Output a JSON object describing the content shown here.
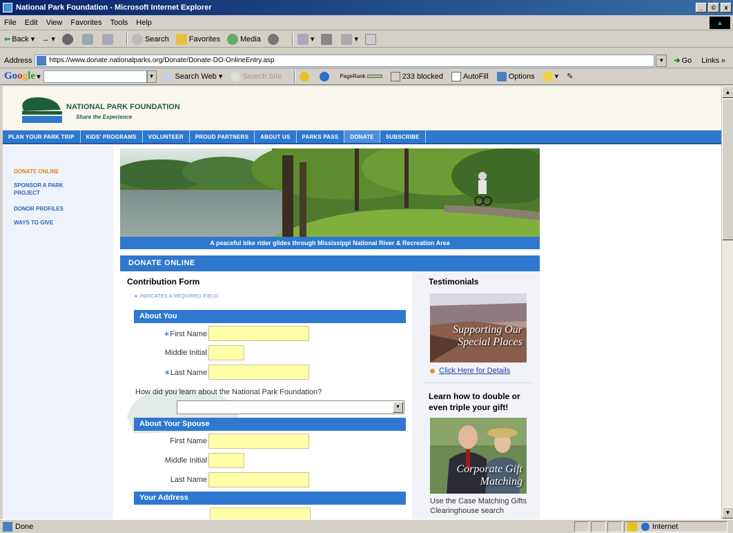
{
  "window": {
    "title": "National Park Foundation - Microsoft Internet Explorer",
    "controls": {
      "minimize": "_",
      "maximize": "©",
      "close": "x"
    }
  },
  "menu": [
    "File",
    "Edit",
    "View",
    "Favorites",
    "Tools",
    "Help"
  ],
  "toolbar": {
    "back": "Back",
    "search": "Search",
    "favorites": "Favorites",
    "media": "Media"
  },
  "address": {
    "label": "Address",
    "url": "https://www.donate.nationalparks.org/Donate/Donate-DO-OnlineEntry.asp",
    "go": "Go",
    "links": "Links »"
  },
  "google_toolbar": {
    "logo": {
      "b": "Go",
      "r": "o",
      "y": "g",
      "g": "le"
    },
    "search_web": "Search Web",
    "search_site": "Search Site",
    "pagerank": "PageRank",
    "blocked": "233 blocked",
    "autofill": "AutoFill",
    "options": "Options"
  },
  "site": {
    "name": "NATIONAL PARK FOUNDATION",
    "tagline": "Share the Experience",
    "nav": [
      "PLAN YOUR PARK TRIP",
      "KIDS' PROGRAMS",
      "VOLUNTEER",
      "PROUD PARTNERS",
      "ABOUT US",
      "PARKS PASS",
      "DONATE",
      "SUBSCRIBE"
    ],
    "active_nav_index": 6,
    "sidebar": [
      "DONATE ONLINE",
      "SPONSOR A PARK PROJECT",
      "DONOR PROFILES",
      "WAYS TO GIVE"
    ],
    "hero_caption": "A peaceful bike rider glides through Mississippi National River & Recreation Area",
    "section_title": "DONATE ONLINE"
  },
  "form": {
    "title": "Contribution Form",
    "required_note": "∗ INDICATES A REQUIRED FIELD",
    "about_you": "About You",
    "first_name": "First Name",
    "middle_initial": "Middle Initial",
    "last_name": "Last Name",
    "required_mark": "∗",
    "how_learn": "How did you learn about the National Park Foundation?",
    "about_spouse": "About Your Spouse",
    "your_address": "Your Address"
  },
  "side": {
    "testimonials": "Testimonials",
    "img1_caption": "Supporting Our Special Places",
    "details_link": "Click Here for Details",
    "learn": "Learn how to double or even triple your gift!",
    "img2_caption": "Corporate Gift Matching",
    "text": "Use the Case Matching Gifts Clearinghouse search"
  },
  "status": {
    "text": "Done",
    "zone": "Internet"
  }
}
